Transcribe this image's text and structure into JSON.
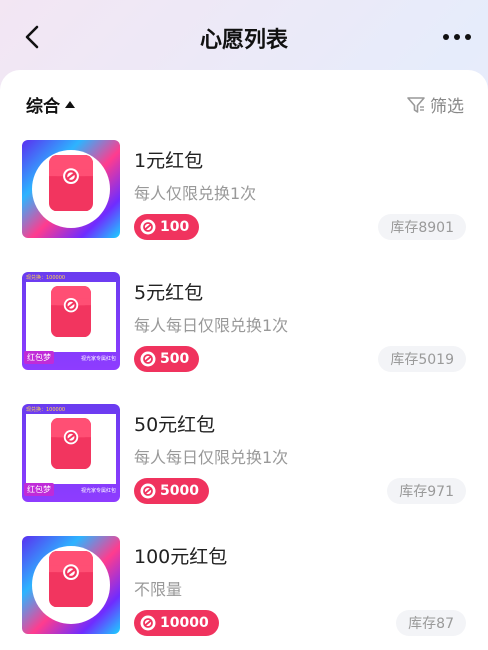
{
  "header": {
    "title": "心愿列表",
    "back_icon": "chevron-left-icon",
    "more_icon": "more-horizontal-icon"
  },
  "toolbar": {
    "sort_label": "综合",
    "filter_label": "筛选",
    "filter_icon": "filter-icon"
  },
  "colors": {
    "accent": "#f0335e",
    "stock_bg": "#f3f4f7"
  },
  "items": [
    {
      "title": "1元红包",
      "desc": "每人仅限兑换1次",
      "points": "100",
      "stock": "库存8901",
      "thumb_style": "swirl"
    },
    {
      "title": "5元红包",
      "desc": "每人每日仅限兑换1次",
      "points": "500",
      "stock": "库存5019",
      "thumb_style": "framed",
      "thumb_tag": "红包梦",
      "thumb_strip": "视光家专属红包",
      "thumb_topline": "现兑换：100000"
    },
    {
      "title": "50元红包",
      "desc": "每人每日仅限兑换1次",
      "points": "5000",
      "stock": "库存971",
      "thumb_style": "framed",
      "thumb_tag": "红包梦",
      "thumb_strip": "视光家专属红包",
      "thumb_topline": "现兑换：100000"
    },
    {
      "title": "100元红包",
      "desc": "不限量",
      "points": "10000",
      "stock": "库存87",
      "thumb_style": "swirl"
    }
  ]
}
